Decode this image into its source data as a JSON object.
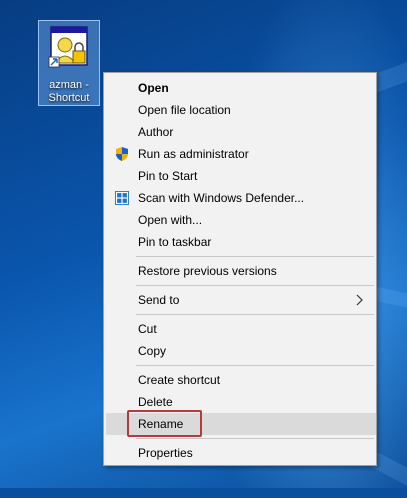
{
  "desktop_icon": {
    "label": "azman -\nShortcut",
    "icon": "admin-tool-icon"
  },
  "context_menu": {
    "items": [
      {
        "label": "Open",
        "bold": true
      },
      {
        "label": "Open file location"
      },
      {
        "label": "Author"
      },
      {
        "label": "Run as administrator",
        "icon": "uac-shield-icon"
      },
      {
        "label": "Pin to Start"
      },
      {
        "label": "Scan with Windows Defender...",
        "icon": "defender-icon"
      },
      {
        "label": "Open with..."
      },
      {
        "label": "Pin to taskbar"
      },
      {
        "label": "Restore previous versions"
      },
      {
        "label": "Send to",
        "submenu": true
      },
      {
        "label": "Cut"
      },
      {
        "label": "Copy"
      },
      {
        "label": "Create shortcut"
      },
      {
        "label": "Delete"
      },
      {
        "label": "Rename",
        "highlighted": true
      },
      {
        "label": "Properties"
      }
    ]
  },
  "colors": {
    "highlight_border": "#b33b3b",
    "menu_bg": "#f2f2f2",
    "hover_bg": "#dadada"
  }
}
